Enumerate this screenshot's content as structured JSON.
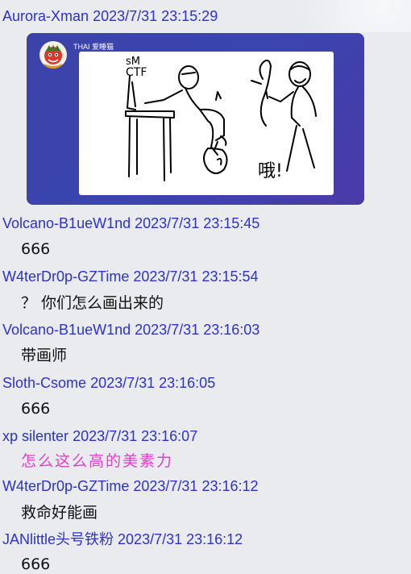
{
  "messages": [
    {
      "author": "Aurora-Xman",
      "time": "2023/7/31 23:15:29",
      "type": "image",
      "image": {
        "label": "THAI 爱睡猫",
        "drawn_text": [
          "sM",
          "CTF",
          "哦!"
        ]
      }
    },
    {
      "author": "Volcano-B1ueW1nd",
      "time": "2023/7/31 23:15:45",
      "text": "666"
    },
    {
      "author": "W4terDr0p-GZTime",
      "time": "2023/7/31 23:15:54",
      "text": "？ 你们怎么画出来的"
    },
    {
      "author": "Volcano-B1ueW1nd",
      "time": "2023/7/31 23:16:03",
      "text": "带画师"
    },
    {
      "author": "Sloth-Csome",
      "time": "2023/7/31 23:16:05",
      "text": "666"
    },
    {
      "author": "xp silenter",
      "time": "2023/7/31 23:16:07",
      "text": "怎么这么高的美素力"
    },
    {
      "author": "W4terDr0p-GZTime",
      "time": "2023/7/31 23:16:12",
      "text": "救命好能画"
    },
    {
      "author": "JANlittle头号铁粉",
      "time": "2023/7/31 23:16:12",
      "text": "666"
    }
  ],
  "colors": {
    "author": "#2d32c9",
    "fancy_text": "#e040c8",
    "background": "#e9ebef"
  }
}
